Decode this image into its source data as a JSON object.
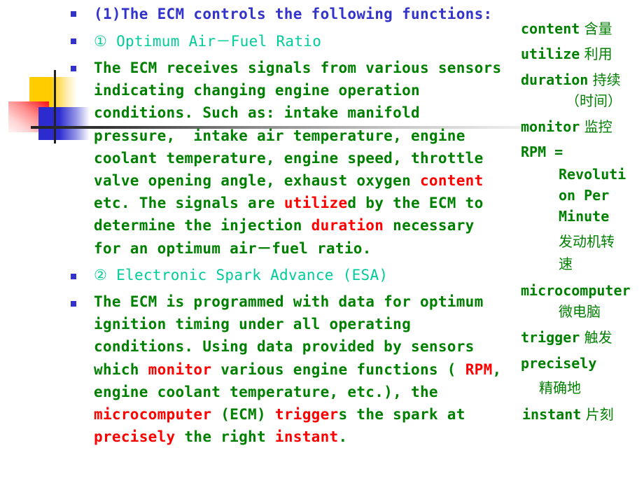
{
  "slide": {
    "colors": {
      "heading": "#3333cc",
      "subheading": "#00cc99",
      "body": "#008000",
      "highlight": "#ff0000",
      "bullet": "#3333cc"
    },
    "heading": "(1)The ECM controls the following functions:",
    "section1_title": "① Optimum Air－Fuel Ratio",
    "section1_body": [
      [
        {
          "t": "The ECM receives signals from various sensors",
          "hl": false
        }
      ],
      [
        {
          "t": "indicating changing engine operation",
          "hl": false
        }
      ],
      [
        {
          "t": "conditions. Such as: intake manifold",
          "hl": false
        }
      ],
      [
        {
          "t": "pressure,  intake air temperature, engine",
          "hl": false
        }
      ],
      [
        {
          "t": "coolant temperature, engine speed, throttle",
          "hl": false
        }
      ],
      [
        {
          "t": "valve opening angle, exhaust oxygen ",
          "hl": false
        },
        {
          "t": "content",
          "hl": true
        }
      ],
      [
        {
          "t": "etc. The signals are ",
          "hl": false
        },
        {
          "t": "utilize",
          "hl": true
        },
        {
          "t": "d by the ECM to",
          "hl": false
        }
      ],
      [
        {
          "t": "determine the injection ",
          "hl": false
        },
        {
          "t": "duration",
          "hl": true
        },
        {
          "t": " necessary",
          "hl": false
        }
      ],
      [
        {
          "t": "for an optimum air－fuel ratio.",
          "hl": false
        }
      ]
    ],
    "section2_title": "② Electronic Spark Advance (ESA)",
    "section2_body": [
      [
        {
          "t": "The ECM is programmed with data for optimum",
          "hl": false
        }
      ],
      [
        {
          "t": "ignition timing under all operating",
          "hl": false
        }
      ],
      [
        {
          "t": "conditions. Using data provided by sensors",
          "hl": false
        }
      ],
      [
        {
          "t": "which ",
          "hl": false
        },
        {
          "t": "monitor",
          "hl": true
        },
        {
          "t": " various engine functions ( ",
          "hl": false
        },
        {
          "t": "RPM",
          "hl": true
        },
        {
          "t": ",",
          "hl": false
        }
      ],
      [
        {
          "t": "engine coolant temperature, etc.), the",
          "hl": false
        }
      ],
      [
        {
          "t": "microcomputer",
          "hl": true
        },
        {
          "t": " (ECM) ",
          "hl": false
        },
        {
          "t": "trigger",
          "hl": true
        },
        {
          "t": "s the spark at",
          "hl": false
        }
      ],
      [
        {
          "t": "precisely",
          "hl": true
        },
        {
          "t": " the right ",
          "hl": false
        },
        {
          "t": "instant",
          "hl": true
        },
        {
          "t": ".",
          "hl": false
        }
      ]
    ]
  },
  "glossary": [
    {
      "en": "content",
      "zh": "含量"
    },
    {
      "en": "utilize",
      "zh": "利用"
    },
    {
      "en": "duration",
      "zh": "持续"
    },
    {
      "en": "",
      "zh": "（时间）"
    },
    {
      "en": "monitor",
      "zh": "监控"
    },
    {
      "en": "RPM =",
      "zh": ""
    },
    {
      "en": "Revoluti",
      "zh": ""
    },
    {
      "en": "on Per",
      "zh": ""
    },
    {
      "en": "Minute",
      "zh": ""
    },
    {
      "en": "",
      "zh": "发动机转"
    },
    {
      "en": "",
      "zh": "速"
    },
    {
      "en": "microcomputer",
      "zh": ""
    },
    {
      "en": "",
      "zh": "微电脑"
    },
    {
      "en": "trigger",
      "zh": "触发"
    },
    {
      "en": "precisely",
      "zh": ""
    },
    {
      "en": "",
      "zh": "精确地"
    },
    {
      "en": "instant",
      "zh": "片刻"
    }
  ]
}
